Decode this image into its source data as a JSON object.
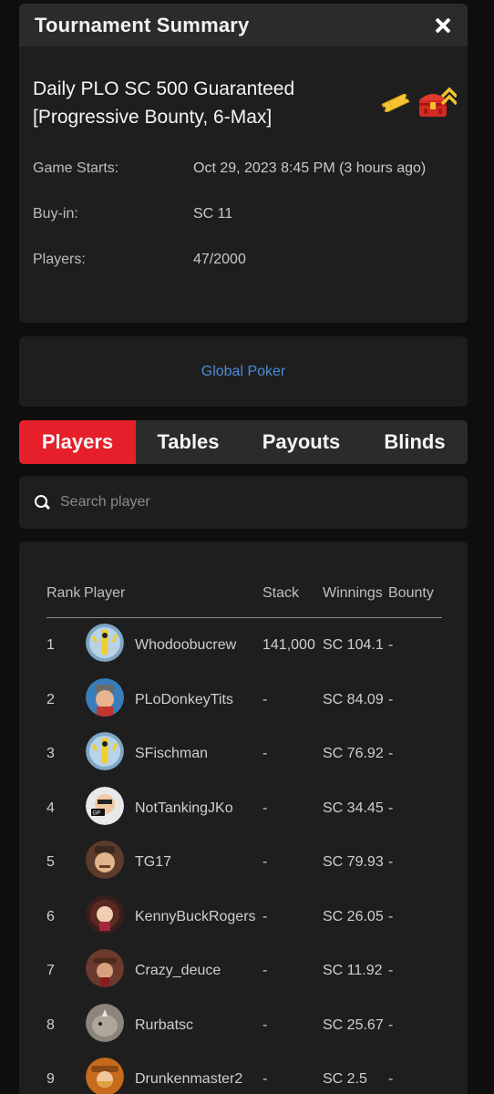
{
  "summary": {
    "title": "Tournament Summary",
    "name_line1": "Daily PLO SC 500 Guaranteed",
    "name_line2": "[Progressive Bounty, 6-Max]",
    "rows": [
      {
        "label": "Game Starts:",
        "value": "Oct 29, 2023 8:45 PM (3 hours ago)"
      },
      {
        "label": "Buy-in:",
        "value": "SC 11"
      },
      {
        "label": "Players:",
        "value": "47/2000"
      }
    ]
  },
  "network": {
    "label": "Global Poker"
  },
  "tabs": [
    {
      "label": "Players",
      "active": true
    },
    {
      "label": "Tables",
      "active": false
    },
    {
      "label": "Payouts",
      "active": false
    },
    {
      "label": "Blinds",
      "active": false
    }
  ],
  "search": {
    "placeholder": "Search player"
  },
  "table": {
    "headers": {
      "rank": "Rank",
      "player": "Player",
      "stack": "Stack",
      "winnings": "Winnings",
      "bounty": "Bounty"
    },
    "rows": [
      {
        "rank": "1",
        "player": "Whodoobucrew",
        "stack": "141,000",
        "winnings": "SC 104.1",
        "bounty": "-",
        "avatar": "tube-man-avatar"
      },
      {
        "rank": "2",
        "player": "PLoDonkeyTits",
        "stack": "-",
        "winnings": "SC 84.09",
        "bounty": "-",
        "avatar": "man-hat-avatar"
      },
      {
        "rank": "3",
        "player": "SFischman",
        "stack": "-",
        "winnings": "SC 76.92",
        "bounty": "-",
        "avatar": "tube-man-avatar"
      },
      {
        "rank": "4",
        "player": "NotTankingJKo",
        "stack": "-",
        "winnings": "SC 34.45",
        "bounty": "-",
        "avatar": "gp-live-avatar"
      },
      {
        "rank": "5",
        "player": "TG17",
        "stack": "-",
        "winnings": "SC 79.93",
        "bounty": "-",
        "avatar": "mobster-avatar"
      },
      {
        "rank": "6",
        "player": "KennyBuckRogers",
        "stack": "-",
        "winnings": "SC 26.05",
        "bounty": "-",
        "avatar": "woman-avatar"
      },
      {
        "rank": "7",
        "player": "Crazy_deuce",
        "stack": "-",
        "winnings": "SC 11.92",
        "bounty": "-",
        "avatar": "cowboy-avatar"
      },
      {
        "rank": "8",
        "player": "Rurbatsc",
        "stack": "-",
        "winnings": "SC 25.67",
        "bounty": "-",
        "avatar": "rhino-avatar"
      },
      {
        "rank": "9",
        "player": "Drunkenmaster2",
        "stack": "-",
        "winnings": "SC 2.5",
        "bounty": "-",
        "avatar": "cowgirl-avatar"
      }
    ]
  },
  "colors": {
    "accent": "#e5202a",
    "link": "#4c8bd8",
    "card": "#1e1e1e",
    "background": "#0e0e0e"
  }
}
